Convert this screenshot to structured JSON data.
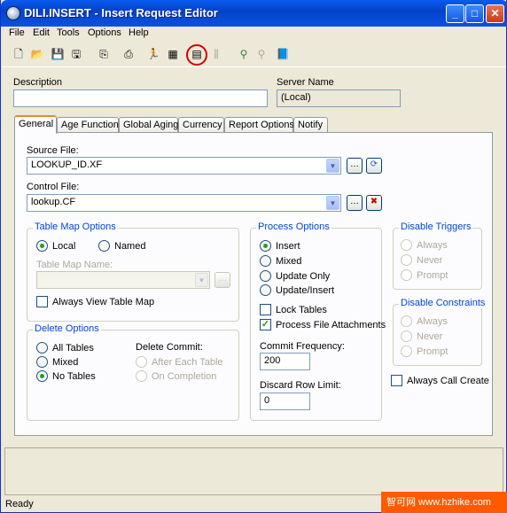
{
  "window": {
    "title": "DILI.INSERT - Insert Request Editor",
    "min": "_",
    "max": "□",
    "close": "✕"
  },
  "menu": [
    "File",
    "Edit",
    "Tools",
    "Options",
    "Help"
  ],
  "header": {
    "description_label": "Description",
    "description_value": "",
    "server_label": "Server Name",
    "server_value": "(Local)"
  },
  "tabs": [
    "General",
    "Age Function",
    "Global Aging",
    "Currency",
    "Report Options",
    "Notify"
  ],
  "general": {
    "source_label": "Source File:",
    "source_value": "LOOKUP_ID.XF",
    "control_label": "Control File:",
    "control_value": "lookup.CF",
    "table_map": {
      "title": "Table Map Options",
      "local": "Local",
      "named": "Named",
      "name_label": "Table Map Name:",
      "name_value": "",
      "always_view": "Always View Table Map"
    },
    "delete": {
      "title": "Delete Options",
      "all": "All Tables",
      "mixed": "Mixed",
      "none": "No Tables",
      "commit_label": "Delete Commit:",
      "after_each": "After Each Table",
      "on_completion": "On Completion"
    },
    "process": {
      "title": "Process Options",
      "insert": "Insert",
      "mixed": "Mixed",
      "update_only": "Update Only",
      "update_insert": "Update/Insert",
      "lock": "Lock Tables",
      "attach": "Process File Attachments",
      "commit_label": "Commit Frequency:",
      "commit_value": "200",
      "discard_label": "Discard Row Limit:",
      "discard_value": "0"
    },
    "triggers": {
      "title": "Disable Triggers",
      "always": "Always",
      "never": "Never",
      "prompt": "Prompt"
    },
    "constraints": {
      "title": "Disable Constraints",
      "always": "Always",
      "never": "Never",
      "prompt": "Prompt"
    },
    "always_call": "Always Call Create"
  },
  "status": {
    "text": "Ready"
  },
  "watermark": "智可网 www.hzhike.com",
  "colors": {
    "title_blue": "#0a5bf0",
    "group_title": "#0046d5",
    "tab_accent": "#e68b2c",
    "check_green": "#21a121",
    "highlight_circle": "#d40000"
  }
}
